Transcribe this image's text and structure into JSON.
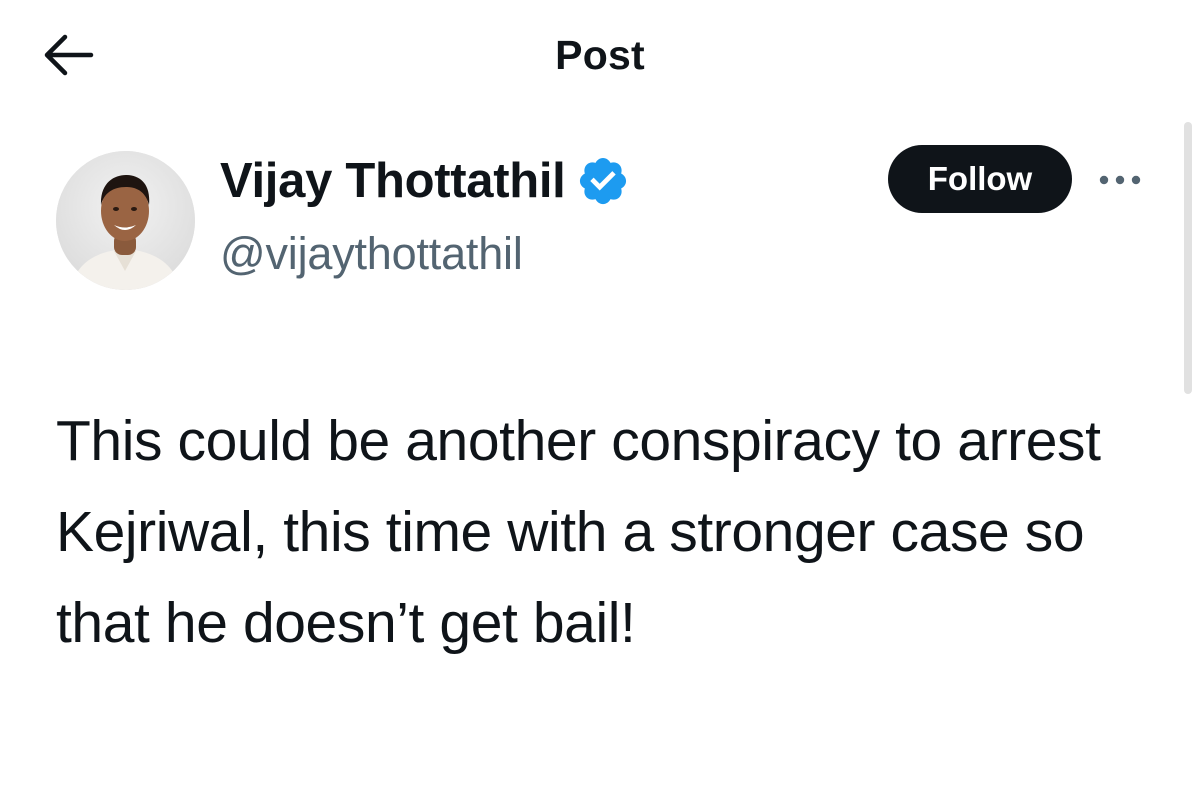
{
  "header": {
    "title": "Post",
    "back_icon": "arrow-left-icon"
  },
  "author": {
    "display_name": "Vijay Thottathil",
    "handle": "@vijaythottathil",
    "verified": true,
    "verified_icon": "verified-badge-icon"
  },
  "actions": {
    "follow_label": "Follow",
    "more_icon": "more-horizontal-icon"
  },
  "post": {
    "text": "This could be another conspiracy to arrest Kejriwal, this time with a stronger case so that he doesn’t get bail!"
  },
  "colors": {
    "text_primary": "#0f1419",
    "text_secondary": "#536471",
    "verified_blue": "#1d9bf0",
    "follow_bg": "#0f1419",
    "follow_text": "#ffffff"
  }
}
